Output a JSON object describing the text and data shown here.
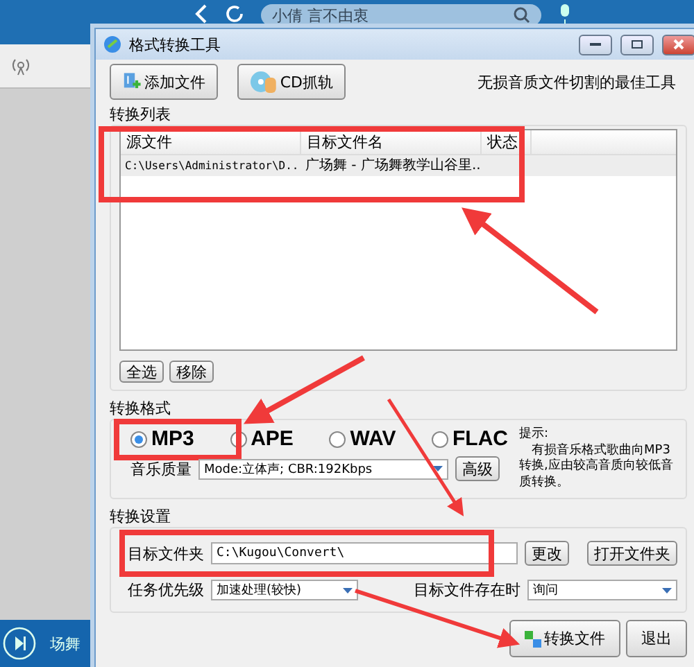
{
  "background_app": {
    "search": {
      "value": "小倩 言不由衷"
    },
    "now_playing": "场舞"
  },
  "window": {
    "title": "格式转换工具"
  },
  "toolbar": {
    "buttons": [
      {
        "label": "添加文件",
        "kind": "add"
      },
      {
        "label": "CD抓轨",
        "kind": "cd"
      }
    ],
    "slogan": "无损音质文件切割的最佳工具"
  },
  "list": {
    "title": "转换列表",
    "columns": [
      "源文件",
      "目标文件名",
      "状态"
    ],
    "rows": [
      {
        "cells": [
          "C:\\Users\\Administrator\\D..",
          "广场舞 - 广场舞教学山谷里..",
          ""
        ],
        "selected": true
      }
    ],
    "buttons": [
      "全选",
      "移除"
    ]
  },
  "format": {
    "title": "转换格式",
    "options": [
      {
        "label": "MP3",
        "selected": true
      },
      {
        "label": "APE",
        "selected": false
      },
      {
        "label": "WAV",
        "selected": false
      },
      {
        "label": "FLAC",
        "selected": false
      }
    ],
    "quality_label": "音乐质量",
    "quality_value": "Mode:立体声; CBR:192Kbps",
    "advanced_button": "高级",
    "tip_title": "提示:",
    "tip_text": "有损音乐格式歌曲向MP3转换,应由较高音质向较低音质转换。"
  },
  "settings": {
    "title": "转换设置",
    "folder_label": "目标文件夹",
    "folder_value": "C:\\Kugou\\Convert\\",
    "change_button": "更改",
    "open_button": "打开文件夹",
    "priority_label": "任务优先级",
    "priority_value": "加速处理(较快)",
    "exists_label": "目标文件存在时",
    "exists_value": "询问"
  },
  "footer_buttons": [
    {
      "label": "转换文件",
      "kind": "convert"
    },
    {
      "label": "退出",
      "kind": "plain"
    }
  ]
}
